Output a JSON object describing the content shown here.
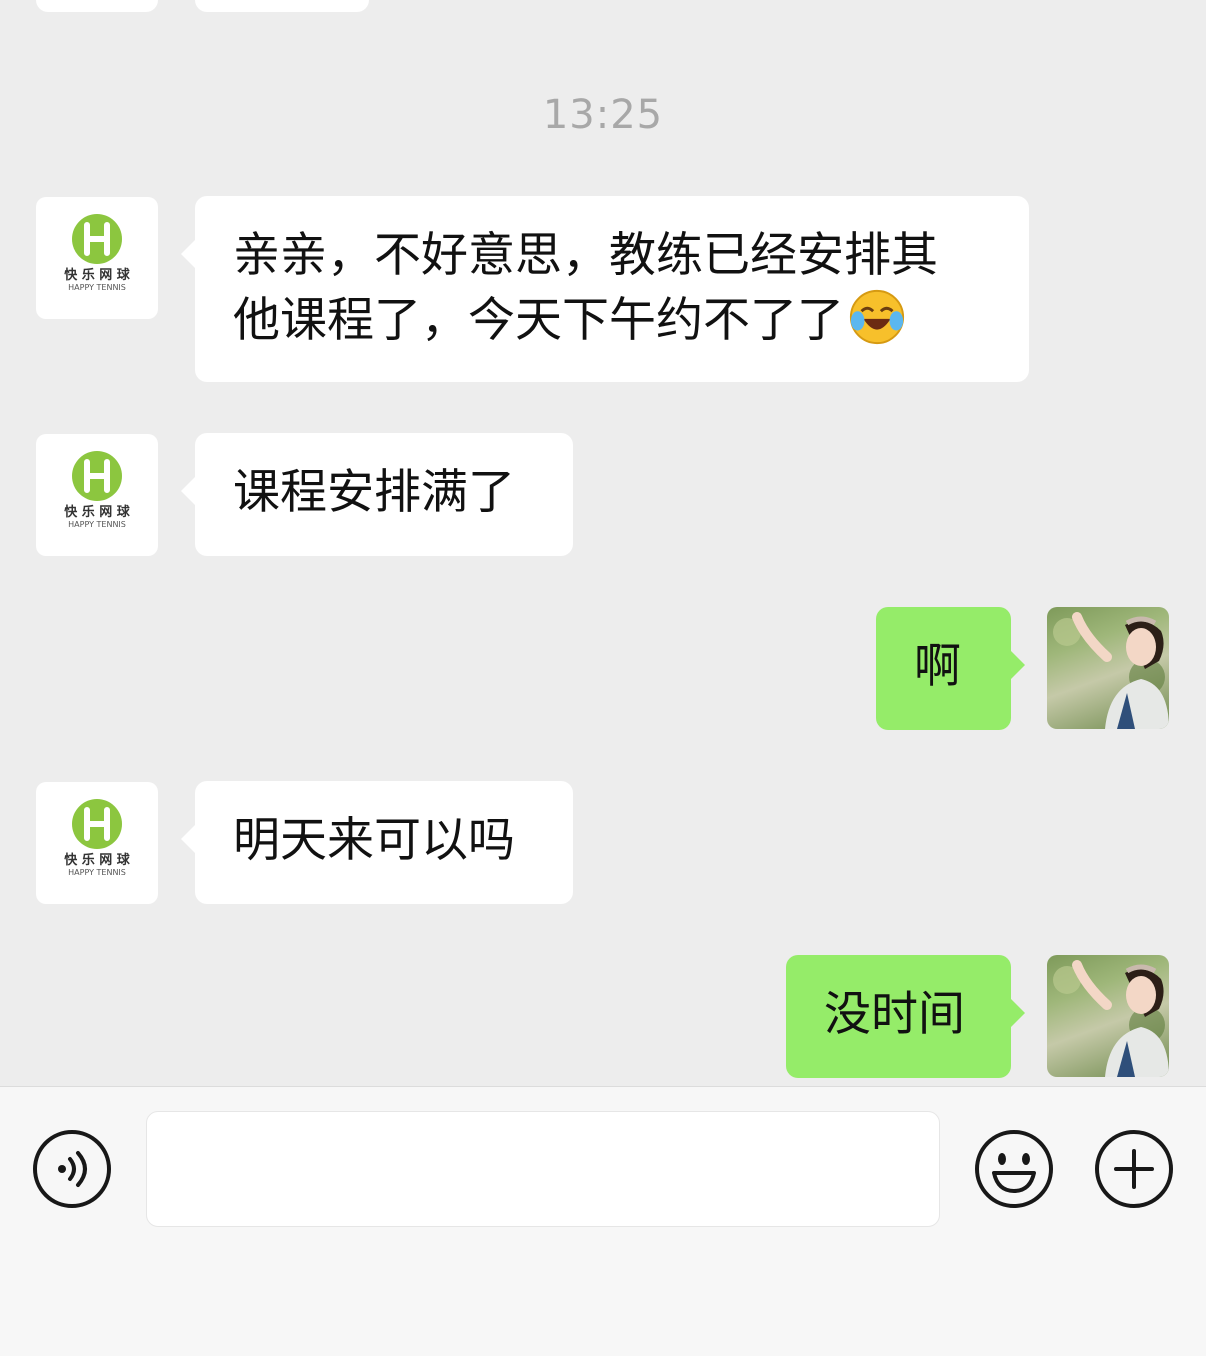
{
  "timestamp": "13:25",
  "messages": [
    {
      "side": "in",
      "sender": "brand",
      "text": "亲亲，不好意思，教练已经安排其\n他课程了，今天下午约不了了",
      "emoji": "laughing-tears-emoji"
    },
    {
      "side": "in",
      "sender": "brand",
      "text": "课程安排满了"
    },
    {
      "side": "out",
      "sender": "user",
      "text": "啊"
    },
    {
      "side": "in",
      "sender": "brand",
      "text": "明天来可以吗"
    },
    {
      "side": "out",
      "sender": "user",
      "text": "没时间"
    }
  ],
  "brand_logo": {
    "name_cn": "快 乐 网 球",
    "name_en": "HAPPY TENNIS",
    "color": "#8cc63f"
  },
  "input_bar": {
    "input_value": "",
    "voice_icon": "voice-icon",
    "emoji_icon": "emoji-icon",
    "plus_icon": "plus-icon"
  },
  "colors": {
    "background": "#ededed",
    "incoming_bubble": "#ffffff",
    "outgoing_bubble": "#95ec69"
  }
}
